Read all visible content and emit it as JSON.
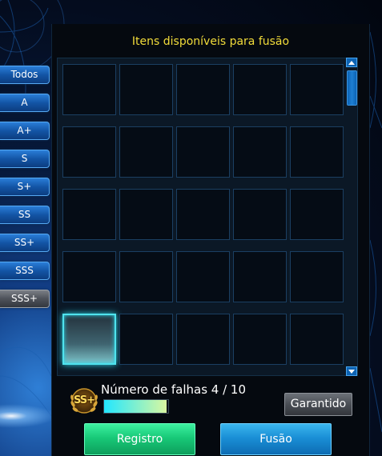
{
  "panel": {
    "title": "Itens disponíveis para fusão"
  },
  "filters": [
    {
      "label": "Todos",
      "selected": false
    },
    {
      "label": "A",
      "selected": false
    },
    {
      "label": "A+",
      "selected": false
    },
    {
      "label": "S",
      "selected": false
    },
    {
      "label": "S+",
      "selected": false
    },
    {
      "label": "SS",
      "selected": false
    },
    {
      "label": "SS+",
      "selected": false
    },
    {
      "label": "SSS",
      "selected": false
    },
    {
      "label": "SSS+",
      "selected": true
    }
  ],
  "grid": {
    "columns": 5,
    "rows": 5,
    "active_slot_index": 20
  },
  "fail": {
    "label": "Número de falhas 4 / 10",
    "badge_text": "SS+",
    "current": 4,
    "max": 10
  },
  "buttons": {
    "garantido": "Garantido",
    "registro": "Registro",
    "fusao": "Fusão"
  },
  "colors": {
    "title": "#f2dc3a",
    "slot_border": "#1b3f62",
    "active_slot_glow": "#4fe3ee",
    "registro": "#18c978",
    "fusao": "#1a8fd6"
  }
}
